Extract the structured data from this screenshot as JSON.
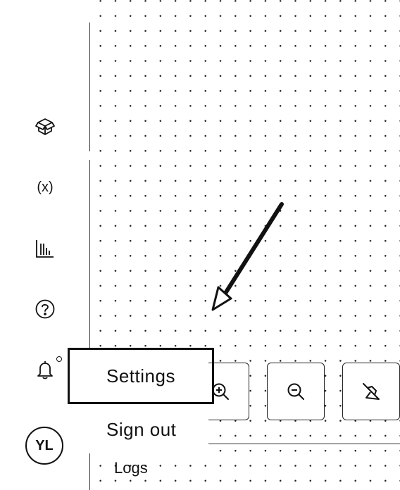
{
  "sidebar": {
    "items": [
      {
        "name": "sidebar-item-packages",
        "icon": "package-icon"
      },
      {
        "name": "sidebar-item-variables",
        "icon": "variable-icon",
        "label": "(x)"
      },
      {
        "name": "sidebar-item-charts",
        "icon": "bar-chart-icon"
      },
      {
        "name": "sidebar-item-help",
        "icon": "help-icon"
      },
      {
        "name": "sidebar-item-notifications",
        "icon": "bell-icon"
      }
    ]
  },
  "user_menu": {
    "items": [
      {
        "label": "Settings",
        "selected": true
      },
      {
        "label": "Sign out",
        "selected": false
      }
    ],
    "partial_item": "Logs"
  },
  "avatar": {
    "initials": "YL"
  },
  "canvas_controls": {
    "zoom_in_icon": "zoom-in-icon",
    "zoom_out_icon": "zoom-out-icon",
    "clear_icon": "broom-icon"
  },
  "colors": {
    "ink": "#111111",
    "background": "#ffffff"
  }
}
